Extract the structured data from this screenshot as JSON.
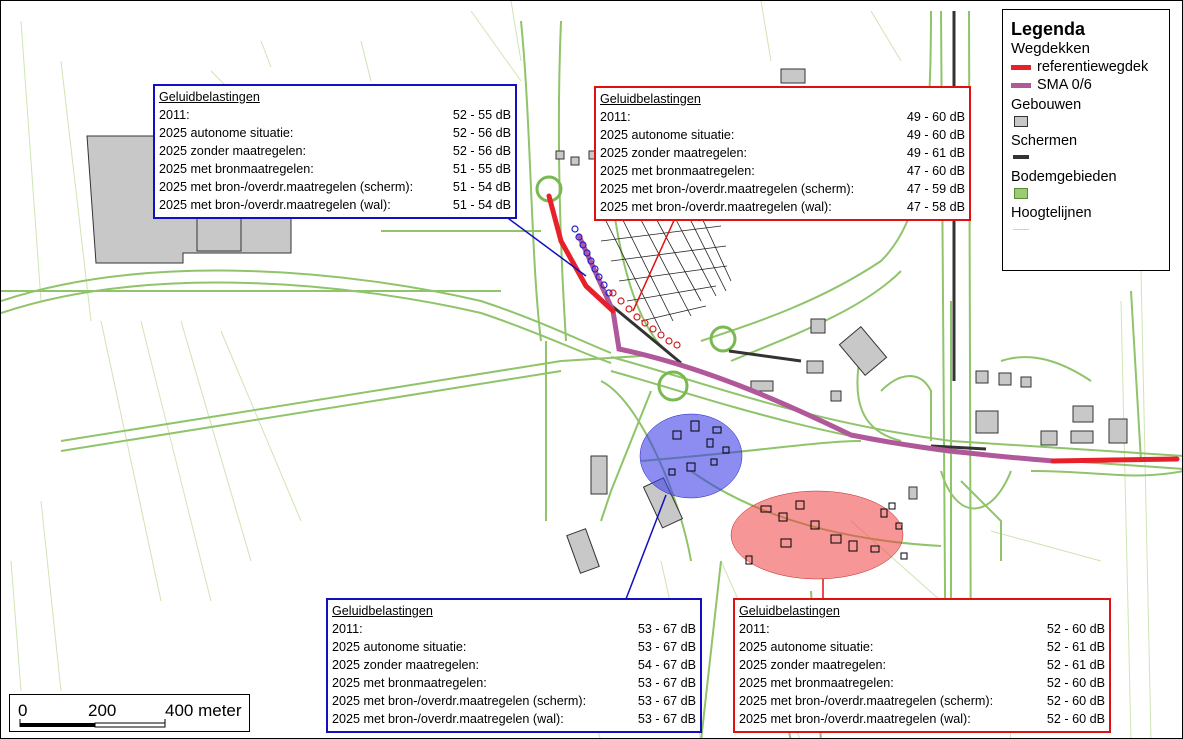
{
  "legend": {
    "title": "Legenda",
    "wegdekken_header": "Wegdekken",
    "items": {
      "referentie": "referentiewegdek",
      "sma": "SMA 0/6",
      "gebouwen": "Gebouwen",
      "schermen": "Schermen",
      "bodem": "Bodemgebieden",
      "hoogte": "Hoogtelijnen"
    },
    "colors": {
      "referentie": "#e8202a",
      "sma": "#b0589a",
      "gebouwen": "#c8c8c8",
      "schermen": "#333333",
      "bodem": "#9ccc72",
      "hoogte": "#c8e0a8"
    }
  },
  "scalebar": {
    "labels": [
      "0",
      "200",
      "400 meter"
    ]
  },
  "zones": {
    "blue_color": "#4040e8",
    "red_color": "#f04040"
  },
  "boxes": {
    "tl": {
      "title": "Geluidbelastingen",
      "rows": [
        {
          "label": "2011:",
          "value": "52 - 55 dB"
        },
        {
          "label": "2025 autonome situatie:",
          "value": "52 - 56 dB"
        },
        {
          "label": "2025 zonder maatregelen:",
          "value": "52 - 56 dB"
        },
        {
          "label": "2025 met bronmaatregelen:",
          "value": "51 - 55 dB"
        },
        {
          "label": "2025 met bron-/overdr.maatregelen (scherm):",
          "value": "51 - 54 dB"
        },
        {
          "label": "2025 met bron-/overdr.maatregelen (wal):",
          "value": "51 - 54 dB"
        }
      ]
    },
    "tr": {
      "title": "Geluidbelastingen",
      "rows": [
        {
          "label": "2011:",
          "value": "49 - 60 dB"
        },
        {
          "label": "2025 autonome situatie:",
          "value": "49 - 60 dB"
        },
        {
          "label": "2025 zonder maatregelen:",
          "value": "49 - 61 dB"
        },
        {
          "label": "2025 met bronmaatregelen:",
          "value": "47 - 60 dB"
        },
        {
          "label": "2025 met bron-/overdr.maatregelen (scherm):",
          "value": "47 - 59 dB"
        },
        {
          "label": "2025 met bron-/overdr.maatregelen (wal):",
          "value": "47 - 58 dB"
        }
      ]
    },
    "bl": {
      "title": "Geluidbelastingen",
      "rows": [
        {
          "label": "2011:",
          "value": "53 - 67 dB"
        },
        {
          "label": "2025 autonome situatie:",
          "value": "53 - 67 dB"
        },
        {
          "label": "2025 zonder maatregelen:",
          "value": "54 - 67 dB"
        },
        {
          "label": "2025 met bronmaatregelen:",
          "value": "53 - 67 dB"
        },
        {
          "label": "2025 met bron-/overdr.maatregelen (scherm):",
          "value": "53 - 67 dB"
        },
        {
          "label": "2025 met bron-/overdr.maatregelen (wal):",
          "value": "53 - 67 dB"
        }
      ]
    },
    "br": {
      "title": "Geluidbelastingen",
      "rows": [
        {
          "label": "2011:",
          "value": "52 - 60 dB"
        },
        {
          "label": "2025 autonome situatie:",
          "value": "52 - 61 dB"
        },
        {
          "label": "2025 zonder maatregelen:",
          "value": "52 - 61 dB"
        },
        {
          "label": "2025 met bronmaatregelen:",
          "value": "52 - 60 dB"
        },
        {
          "label": "2025 met bron-/overdr.maatregelen (scherm):",
          "value": "52 - 60 dB"
        },
        {
          "label": "2025 met bron-/overdr.maatregelen (wal):",
          "value": "52 - 60 dB"
        }
      ]
    }
  }
}
